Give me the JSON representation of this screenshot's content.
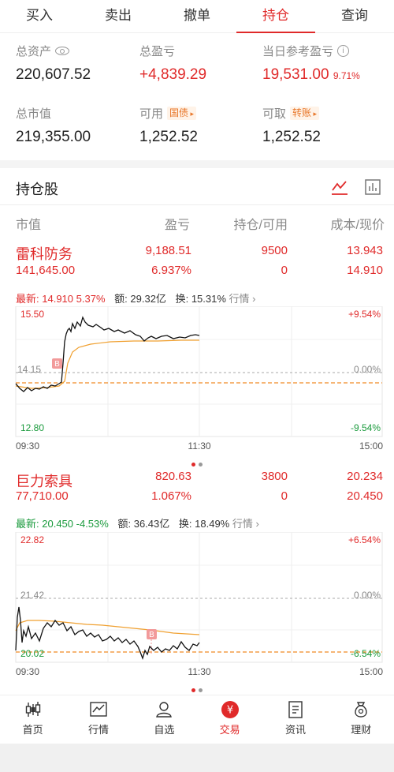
{
  "tabs": [
    "买入",
    "卖出",
    "撤单",
    "持仓",
    "查询"
  ],
  "active_tab": "持仓",
  "summary": {
    "total_assets_label": "总资产",
    "total_assets": "220,607.52",
    "total_pl_label": "总盈亏",
    "total_pl": "+4,839.29",
    "day_pl_label": "当日参考盈亏",
    "day_pl": "19,531.00",
    "day_pl_pct": "9.71%",
    "market_value_label": "总市值",
    "market_value": "219,355.00",
    "available_label": "可用",
    "available_tag": "国债",
    "available": "1,252.52",
    "withdrawable_label": "可取",
    "withdrawable_tag": "转账",
    "withdrawable": "1,252.52"
  },
  "holdings": {
    "title": "持仓股",
    "columns": [
      "市值",
      "盈亏",
      "持仓/可用",
      "成本/现价"
    ],
    "stocks": [
      {
        "name": "雷科防务",
        "market_value": "141,645.00",
        "pl": "9,188.51",
        "pl_pct": "6.937%",
        "position": "9500",
        "available": "0",
        "cost": "13.943",
        "price": "14.910",
        "quote": {
          "latest_label": "最新:",
          "latest": "14.910",
          "change": "5.37%",
          "amount_label": "额:",
          "amount": "29.32亿",
          "turnover_label": "换:",
          "turnover": "15.31%",
          "link": "行情"
        },
        "chart": {
          "y_top": "15.50",
          "y_mid": "14.15",
          "y_bot": "12.80",
          "pct_top": "+9.54%",
          "pct_mid": "0.00%",
          "pct_bot": "-9.54%",
          "x_start": "09:30",
          "x_mid": "11:30",
          "x_end": "15:00",
          "marker": "B"
        }
      },
      {
        "name": "巨力索具",
        "market_value": "77,710.00",
        "pl": "820.63",
        "pl_pct": "1.067%",
        "position": "3800",
        "available": "0",
        "cost": "20.234",
        "price": "20.450",
        "quote": {
          "latest_label": "最新:",
          "latest": "20.450",
          "change": "-4.53%",
          "amount_label": "额:",
          "amount": "36.43亿",
          "turnover_label": "换:",
          "turnover": "18.49%",
          "link": "行情"
        },
        "chart": {
          "y_top": "22.82",
          "y_mid": "21.42",
          "y_bot": "20.02",
          "pct_top": "+6.54%",
          "pct_mid": "0.00%",
          "pct_bot": "-6.54%",
          "x_start": "09:30",
          "x_mid": "11:30",
          "x_end": "15:00",
          "marker": "B"
        }
      }
    ]
  },
  "nav": [
    "首页",
    "行情",
    "自选",
    "交易",
    "资讯",
    "理财"
  ],
  "nav_active": "交易",
  "colors": {
    "accent": "#e02a2a",
    "down": "#1a9a3c",
    "avg_line": "#f0a030"
  }
}
